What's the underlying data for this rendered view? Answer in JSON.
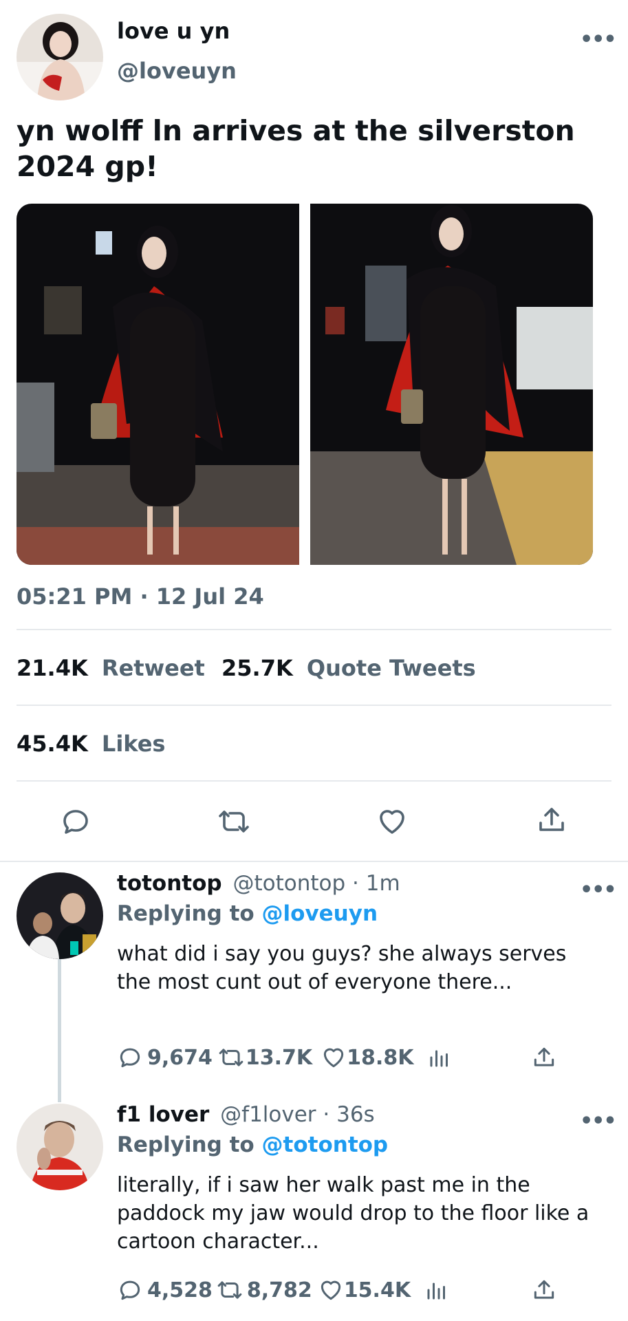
{
  "tweet": {
    "display_name": "love u yn",
    "handle": "@loveuyn",
    "text": "yn wolff ln arrives at the silverston 2024 gp!",
    "timestamp": "05:21 PM · 12 Jul 24",
    "stats": {
      "retweets_count": "21.4K",
      "retweets_label": "Retweet",
      "quotes_count": "25.7K",
      "quotes_label": "Quote Tweets",
      "likes_count": "45.4K",
      "likes_label": "Likes"
    }
  },
  "replies": [
    {
      "display_name": "totontop",
      "handle": "@totontop · 1m",
      "replying_prefix": "Replying to",
      "replying_to": "@loveuyn",
      "text": "what did i say you guys? she always serves the most cunt out of everyone there...",
      "replies_count": "9,674",
      "retweets_count": "13.7K",
      "likes_count": "18.8K"
    },
    {
      "display_name": "f1 lover",
      "handle": "@f1lover · 36s",
      "replying_prefix": "Replying to",
      "replying_to": "@totontop",
      "text": "literally, if i saw her walk past me in the paddock my jaw would drop to the floor like a cartoon character...",
      "replies_count": "4,528",
      "retweets_count": "8,782",
      "likes_count": "15.4K"
    }
  ],
  "icons": [
    "more-icon",
    "reply-icon",
    "retweet-icon",
    "like-icon",
    "share-icon",
    "analytics-icon"
  ]
}
